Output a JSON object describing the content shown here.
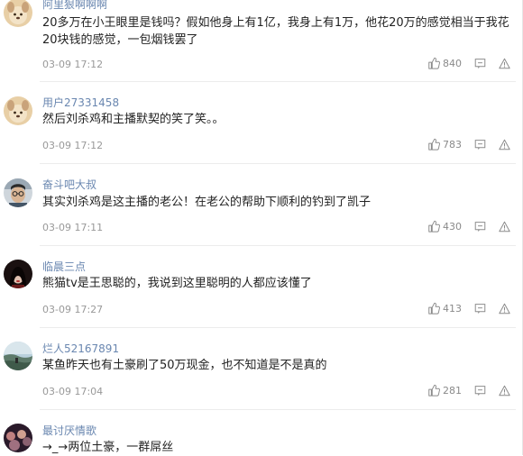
{
  "comments": [
    {
      "user": "阿里狠啊啊啊",
      "text": "20多万在小王眼里是钱吗？假如他身上有1亿，我身上有1万，他花20万的感觉相当于我花20块钱的感觉，一包烟钱罢了",
      "time": "03-09 17:12",
      "likes": "840",
      "avatar": "cartoon-dog"
    },
    {
      "user": "用户27331458",
      "text": "然后刘杀鸡和主播默契的笑了笑。。",
      "time": "03-09 17:12",
      "likes": "783",
      "avatar": "cartoon-dog"
    },
    {
      "user": "奋斗吧大叔",
      "text": "其实刘杀鸡是这主播的老公！在老公的帮助下顺利的钓到了凯子",
      "time": "03-09 17:11",
      "likes": "430",
      "avatar": "man-glasses"
    },
    {
      "user": "临晨三点",
      "text": "熊猫tv是王思聪的，我说到这里聪明的人都应该懂了",
      "time": "03-09 17:27",
      "likes": "413",
      "avatar": "dark-portrait"
    },
    {
      "user": "烂人52167891",
      "text": "某鱼昨天也有土豪刷了50万现金，也不知道是不是真的",
      "time": "03-09 17:04",
      "likes": "281",
      "avatar": "landscape"
    },
    {
      "user": "最讨厌情歌",
      "text": "→_→两位土豪，一群屌丝",
      "avatar": "crowd"
    }
  ]
}
